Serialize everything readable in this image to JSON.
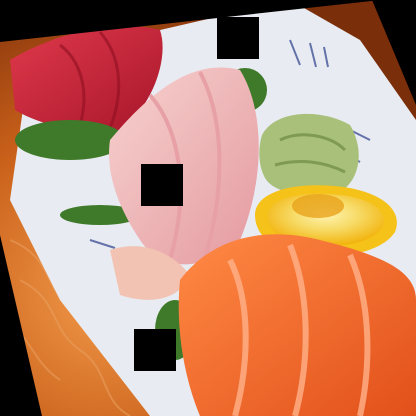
{
  "image": {
    "subject": "sashimi plate",
    "items": [
      "tuna-sashimi",
      "yellowtail-sashimi",
      "salmon-sashimi",
      "wasabi",
      "lemon-slice",
      "pickled-ginger",
      "seaweed-garnish",
      "blue-white-plate",
      "wooden-table"
    ],
    "occlusions": 3
  },
  "colors": {
    "background_black": "#000000",
    "table_wood": "#c9601a",
    "plate_white": "#e8ecf2",
    "tuna_red": "#c8243a",
    "yellowtail_pink": "#f0b8b8",
    "salmon_orange": "#f06a2a",
    "wasabi_green": "#a9c07a",
    "lemon_yellow": "#f5c21a",
    "garnish_green": "#3f7a2a"
  }
}
